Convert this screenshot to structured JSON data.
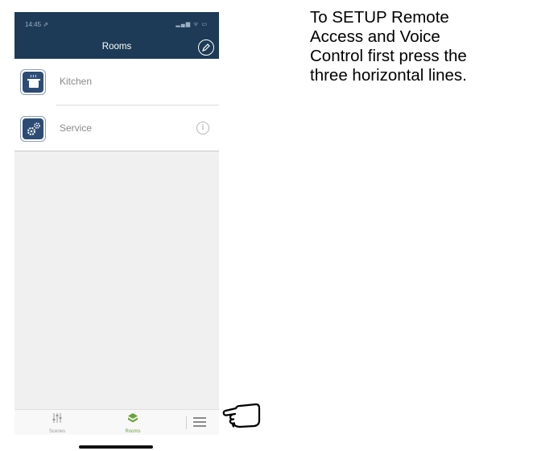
{
  "status_bar": {
    "time": "14:45 ⇗",
    "indicators": "▂▄▆ ᯤ ▭"
  },
  "nav": {
    "title": "Rooms",
    "edit_icon": "pencil-circle-icon"
  },
  "rooms": [
    {
      "label": "Kitchen",
      "icon": "cooking-pot-icon",
      "has_info": false
    },
    {
      "label": "Service",
      "icon": "gears-icon",
      "has_info": true,
      "info_glyph": "i"
    }
  ],
  "tabbar": {
    "tabs": [
      {
        "label": "Scenes",
        "icon": "sliders-icon",
        "active": false
      },
      {
        "label": "Rooms",
        "icon": "rooms-cube-icon",
        "active": true
      }
    ],
    "menu_icon": "hamburger-icon"
  },
  "colors": {
    "nav_background": "#1d3a56",
    "room_icon_background": "#2d4c75",
    "active_tab": "#6aa33a",
    "list_background": "#f0f0f0"
  },
  "annotation": {
    "text": "To SETUP Remote\nAccess and Voice\nControl first press the\nthree horizontal lines.",
    "pointer_icon": "pointing-hand-icon"
  }
}
